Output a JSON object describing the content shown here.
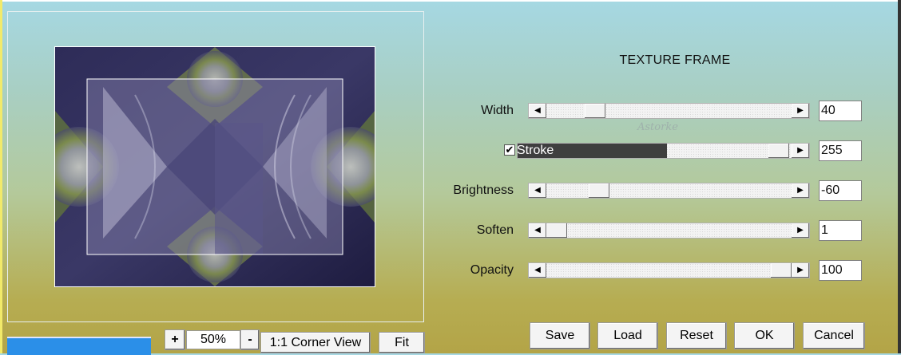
{
  "plugin": {
    "title": "TEXTURE FRAME",
    "watermark": "Astorke"
  },
  "preview": {
    "zoom_in_label": "+",
    "zoom_value": "50%",
    "zoom_out_label": "-",
    "corner_view_label": "1:1 Corner View",
    "fit_label": "Fit"
  },
  "params": [
    {
      "label": "Width",
      "value": "40",
      "fraction": 0.17
    },
    {
      "label": "Stroke",
      "value": "255",
      "fraction": 1.0,
      "checked": true
    },
    {
      "label": "Brightness",
      "value": "-60",
      "fraction": 0.19
    },
    {
      "label": "Soften",
      "value": "1",
      "fraction": 0.0
    },
    {
      "label": "Opacity",
      "value": "100",
      "fraction": 1.0
    }
  ],
  "slider_arrows": {
    "left": "◀",
    "right": "▶"
  },
  "checkbox_mark": "✔",
  "buttons": {
    "save": "Save",
    "load": "Load",
    "reset": "Reset",
    "ok": "OK",
    "cancel": "Cancel"
  },
  "colors": {
    "stroke_fill": "#3f3f3f",
    "accent_blue": "#2b8fe8"
  }
}
